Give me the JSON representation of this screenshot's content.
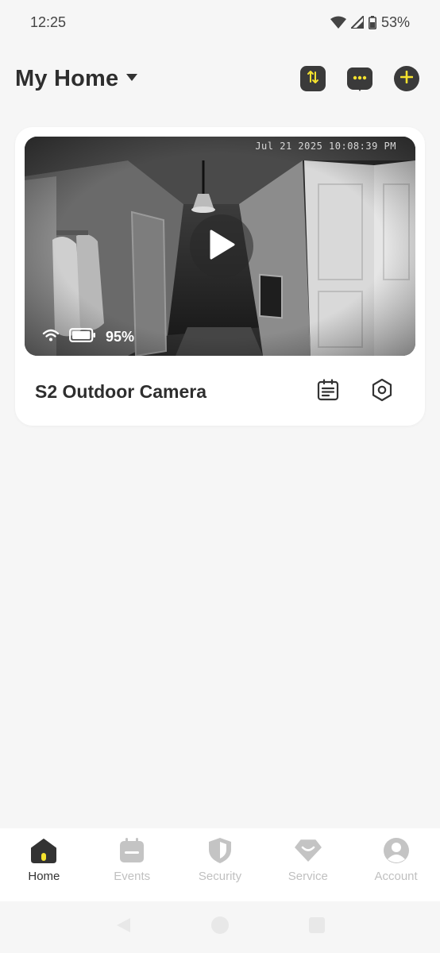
{
  "status_bar": {
    "time": "12:25",
    "battery": "53%"
  },
  "header": {
    "title": "My Home",
    "actions": [
      {
        "name": "switch-icon"
      },
      {
        "name": "messages-icon"
      },
      {
        "name": "add-icon"
      }
    ]
  },
  "colors": {
    "accent": "#f5e22e",
    "dark": "#3a3a3a",
    "background": "#f6f6f6",
    "card": "#ffffff",
    "nav_inactive": "#c0c0c0"
  },
  "camera_card": {
    "timestamp": "Jul 21 2025 10:08:39 PM",
    "battery_level": "95%",
    "device_name": "S2 Outdoor Camera",
    "actions": [
      {
        "name": "event-log-icon"
      },
      {
        "name": "settings-icon"
      }
    ]
  },
  "bottom_nav": {
    "items": [
      {
        "label": "Home",
        "icon": "home-icon",
        "active": true
      },
      {
        "label": "Events",
        "icon": "events-icon",
        "active": false
      },
      {
        "label": "Security",
        "icon": "shield-icon",
        "active": false
      },
      {
        "label": "Service",
        "icon": "service-icon",
        "active": false
      },
      {
        "label": "Account",
        "icon": "account-icon",
        "active": false
      }
    ]
  }
}
